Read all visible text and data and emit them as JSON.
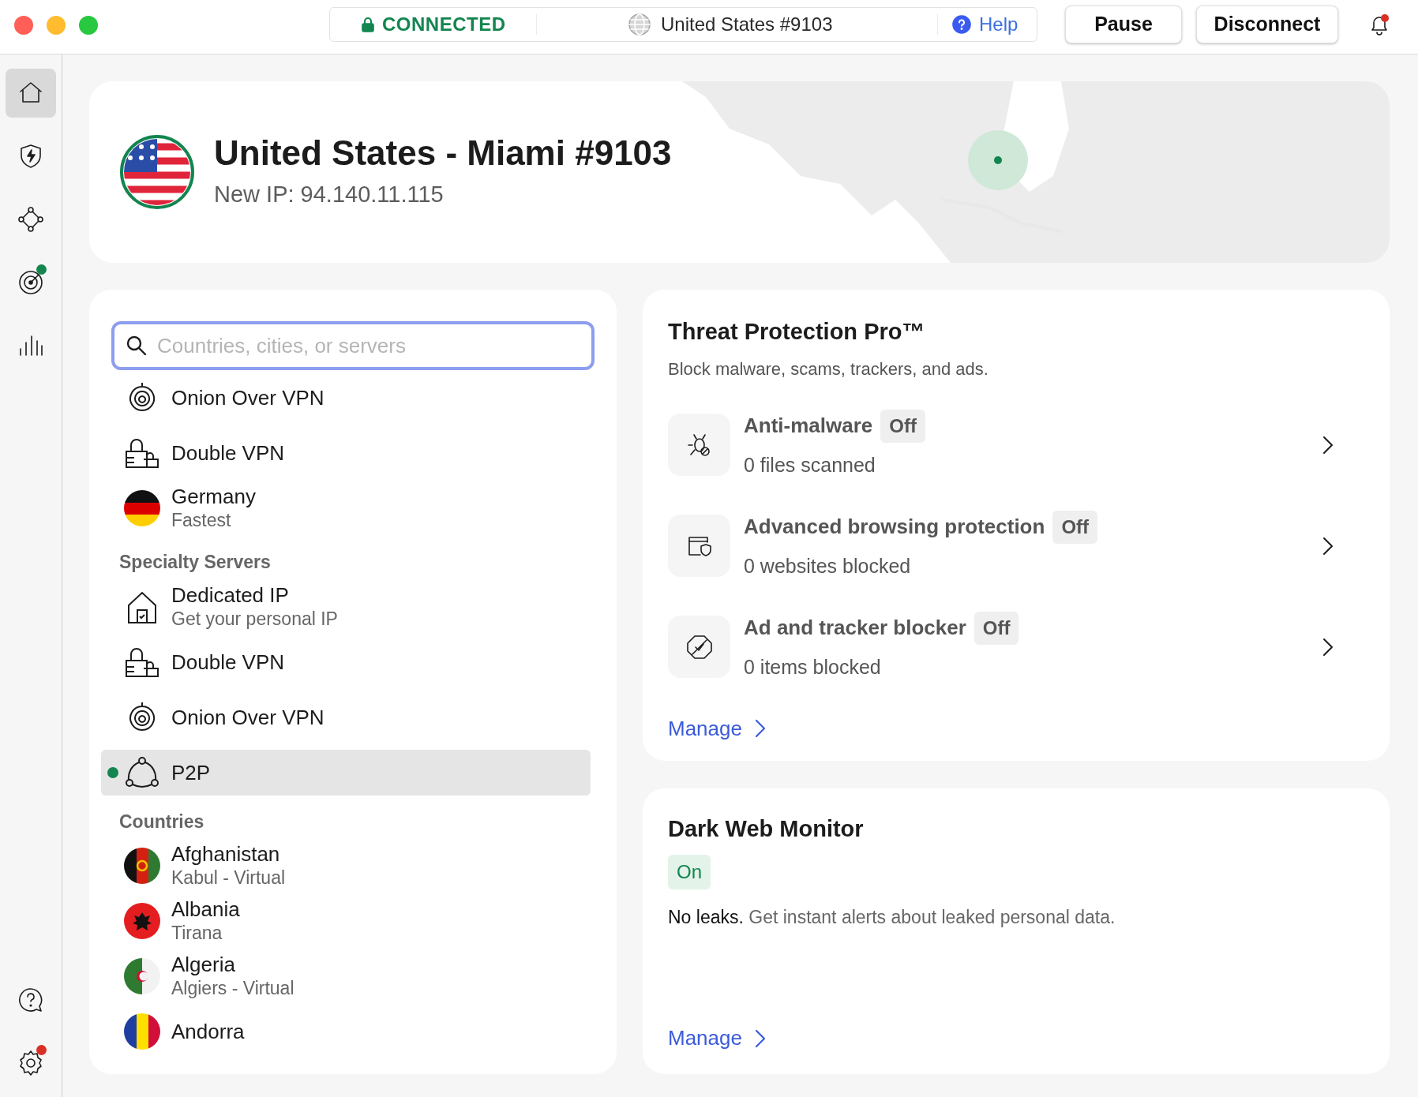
{
  "top_bar": {
    "status": "CONNECTED",
    "server": "United States #9103",
    "help": "Help",
    "buttons": [
      "Pause",
      "Disconnect"
    ],
    "alert": true
  },
  "nav": [
    {
      "kind": "home",
      "selected": true
    },
    {
      "kind": "shield",
      "selected": false
    },
    {
      "kind": "mesh",
      "selected": false
    },
    {
      "kind": "target",
      "selected": false,
      "color": "#13854f"
    },
    {
      "kind": "stats",
      "selected": false
    },
    {
      "kind": "help",
      "selected": false
    },
    {
      "kind": "settings",
      "selected": false,
      "color": "#d93025"
    }
  ],
  "connection": {
    "title": "United States - Miami #9103",
    "ip": "New IP: 94.140.11.115"
  },
  "search": {
    "placeholder": "Countries, cities, or servers"
  },
  "server_list": [
    {
      "kind": "onion",
      "name": "Onion Over VPN",
      "selected": false
    },
    {
      "kind": "double",
      "name": "Double VPN",
      "selected": false
    },
    {
      "kind": "de",
      "name": "Germany",
      "detail": "Fastest",
      "selected": false
    },
    {
      "kind": "header",
      "name": "Specialty Servers"
    },
    {
      "kind": "dedicated",
      "name": "Dedicated IP",
      "detail": "Get your personal IP",
      "selected": false
    },
    {
      "kind": "double",
      "name": "Double VPN",
      "selected": false
    },
    {
      "kind": "onion",
      "name": "Onion Over VPN",
      "selected": false
    },
    {
      "kind": "p2p",
      "name": "P2P",
      "selected": true
    },
    {
      "kind": "header",
      "name": "Countries"
    },
    {
      "kind": "af",
      "name": "Afghanistan",
      "detail": "Kabul - Virtual",
      "selected": false
    },
    {
      "kind": "al",
      "name": "Albania",
      "detail": "Tirana",
      "selected": false
    },
    {
      "kind": "dz",
      "name": "Algeria",
      "detail": "Algiers - Virtual",
      "selected": false
    },
    {
      "kind": "ad",
      "name": "Andorra",
      "selected": false
    }
  ],
  "threat_protection": {
    "title": "Threat Protection Pro™",
    "subtitle": "Block malware, scams, trackers, and ads.",
    "features": [
      {
        "kind": "malware",
        "name": "Anti-malware",
        "status": "Off",
        "on": false,
        "detail": "0 files scanned"
      },
      {
        "kind": "browsing",
        "name": "Advanced browsing protection",
        "status": "Off",
        "on": false,
        "detail": "0 websites blocked"
      },
      {
        "kind": "adblock",
        "name": "Ad and tracker blocker",
        "status": "Off",
        "on": false,
        "detail": "0 items blocked"
      }
    ],
    "link": "Manage"
  },
  "dark_web_monitor": {
    "title": "Dark Web Monitor",
    "status": "On",
    "on": true,
    "lead": "No leaks.",
    "text": "Get instant alerts about leaked personal data.",
    "link": "Manage"
  }
}
